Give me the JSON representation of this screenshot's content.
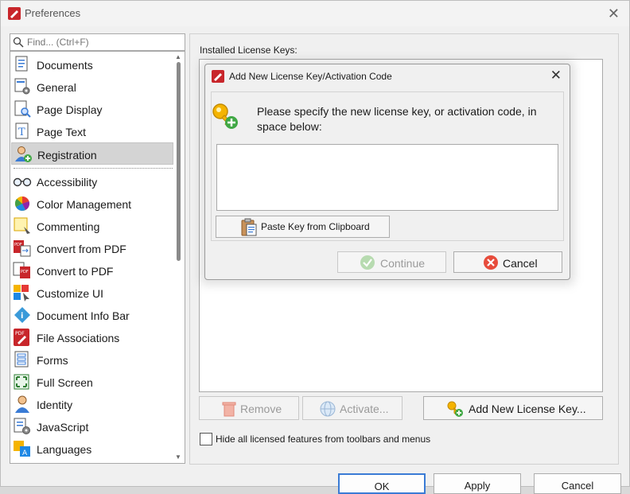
{
  "window": {
    "title": "Preferences"
  },
  "search": {
    "placeholder": "Find... (Ctrl+F)"
  },
  "categories_top": [
    {
      "label": "Documents",
      "icon": "documents-icon"
    },
    {
      "label": "General",
      "icon": "general-icon"
    },
    {
      "label": "Page Display",
      "icon": "page-display-icon"
    },
    {
      "label": "Page Text",
      "icon": "page-text-icon"
    },
    {
      "label": "Registration",
      "icon": "registration-icon",
      "selected": true
    }
  ],
  "categories": [
    {
      "label": "Accessibility",
      "icon": "accessibility-icon"
    },
    {
      "label": "Color Management",
      "icon": "color-management-icon"
    },
    {
      "label": "Commenting",
      "icon": "commenting-icon"
    },
    {
      "label": "Convert from PDF",
      "icon": "convert-from-pdf-icon"
    },
    {
      "label": "Convert to PDF",
      "icon": "convert-to-pdf-icon"
    },
    {
      "label": "Customize UI",
      "icon": "customize-ui-icon"
    },
    {
      "label": "Document Info Bar",
      "icon": "document-info-bar-icon"
    },
    {
      "label": "File Associations",
      "icon": "file-associations-icon"
    },
    {
      "label": "Forms",
      "icon": "forms-icon"
    },
    {
      "label": "Full Screen",
      "icon": "full-screen-icon"
    },
    {
      "label": "Identity",
      "icon": "identity-icon"
    },
    {
      "label": "JavaScript",
      "icon": "javascript-icon"
    },
    {
      "label": "Languages",
      "icon": "languages-icon"
    }
  ],
  "registration": {
    "installed_label": "Installed License Keys:",
    "remove_label": "Remove",
    "activate_label": "Activate...",
    "add_label": "Add New License Key...",
    "hide_label": "Hide all licensed features from toolbars and menus"
  },
  "footer": {
    "ok_label": "OK",
    "apply_label": "Apply",
    "cancel_label": "Cancel"
  },
  "dialog": {
    "title": "Add New License Key/Activation Code",
    "message": "Please specify the new license key, or activation code, in space below:",
    "paste_label": "Paste Key from Clipboard",
    "continue_label": "Continue",
    "cancel_label": "Cancel"
  },
  "colors": {
    "accent": "#3a7bd5",
    "selection": "#d4d4d4",
    "brand_red": "#c8262b"
  }
}
